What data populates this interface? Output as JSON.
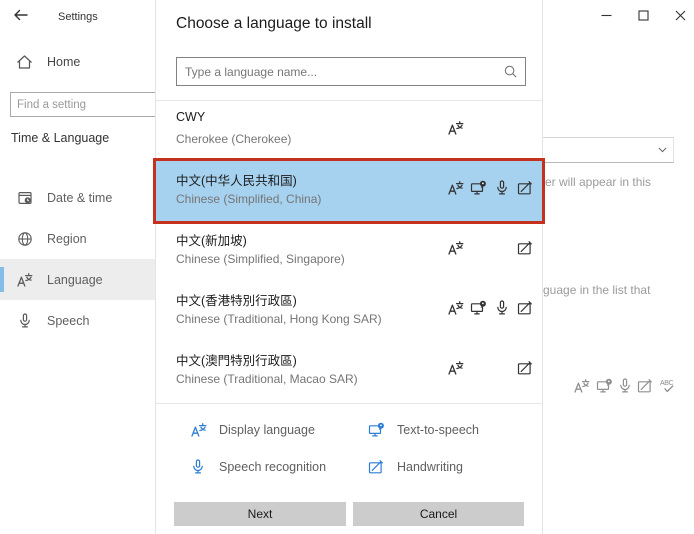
{
  "window": {
    "controls": [
      "minimize-icon",
      "maximize-icon",
      "close-icon"
    ]
  },
  "sidebar": {
    "back_icon": "back-arrow-icon",
    "title": "Settings",
    "home_label": "Home",
    "home_icon": "home-icon",
    "search_placeholder": "Find a setting",
    "section": "Time & Language",
    "items": [
      {
        "label": "Date & time",
        "icon": "datetime-icon",
        "selected": false
      },
      {
        "label": "Region",
        "icon": "region-icon",
        "selected": false
      },
      {
        "label": "Language",
        "icon": "display-language-icon",
        "selected": true
      },
      {
        "label": "Speech",
        "icon": "speech-recognition-icon",
        "selected": false
      }
    ]
  },
  "dialog": {
    "title": "Choose a language to install",
    "search_placeholder": "Type a language name...",
    "search_icon": "search-icon",
    "languages": [
      {
        "native": "CWY",
        "english": "Cherokee (Cherokee)",
        "features": [
          "display"
        ],
        "selected": false
      },
      {
        "native": "中文(中华人民共和国)",
        "english": "Chinese (Simplified, China)",
        "features": [
          "display",
          "tts",
          "speech",
          "handwriting"
        ],
        "selected": true
      },
      {
        "native": "中文(新加坡)",
        "english": "Chinese (Simplified, Singapore)",
        "features": [
          "display",
          "handwriting"
        ],
        "selected": false
      },
      {
        "native": "中文(香港特別行政區)",
        "english": "Chinese (Traditional, Hong Kong SAR)",
        "features": [
          "display",
          "tts",
          "speech",
          "handwriting"
        ],
        "selected": false
      },
      {
        "native": "中文(澳門特別行政區)",
        "english": "Chinese (Traditional, Macao SAR)",
        "features": [
          "display",
          "handwriting"
        ],
        "selected": false
      }
    ],
    "legend": [
      {
        "label": "Display language",
        "icon": "display-language-icon"
      },
      {
        "label": "Text-to-speech",
        "icon": "text-to-speech-icon"
      },
      {
        "label": "Speech recognition",
        "icon": "speech-recognition-icon"
      },
      {
        "label": "Handwriting",
        "icon": "handwriting-icon"
      }
    ],
    "next_label": "Next",
    "cancel_label": "Cancel"
  },
  "background_page": {
    "dropdown_chevron": "chevron-down-icon",
    "fragment_1": "er will appear in this",
    "fragment_2": "guage in the list that",
    "feature_icons": [
      "display-language-icon",
      "text-to-speech-icon",
      "speech-recognition-icon",
      "handwriting-icon",
      "spellcheck-icon"
    ]
  },
  "colors": {
    "selection_blue": "#a6d1ef",
    "highlight_border_red": "#c5311d",
    "legend_icon_blue": "#2b7cd3",
    "button_gray": "#cccccc",
    "sidebar_accent_blue": "#83bde8"
  }
}
